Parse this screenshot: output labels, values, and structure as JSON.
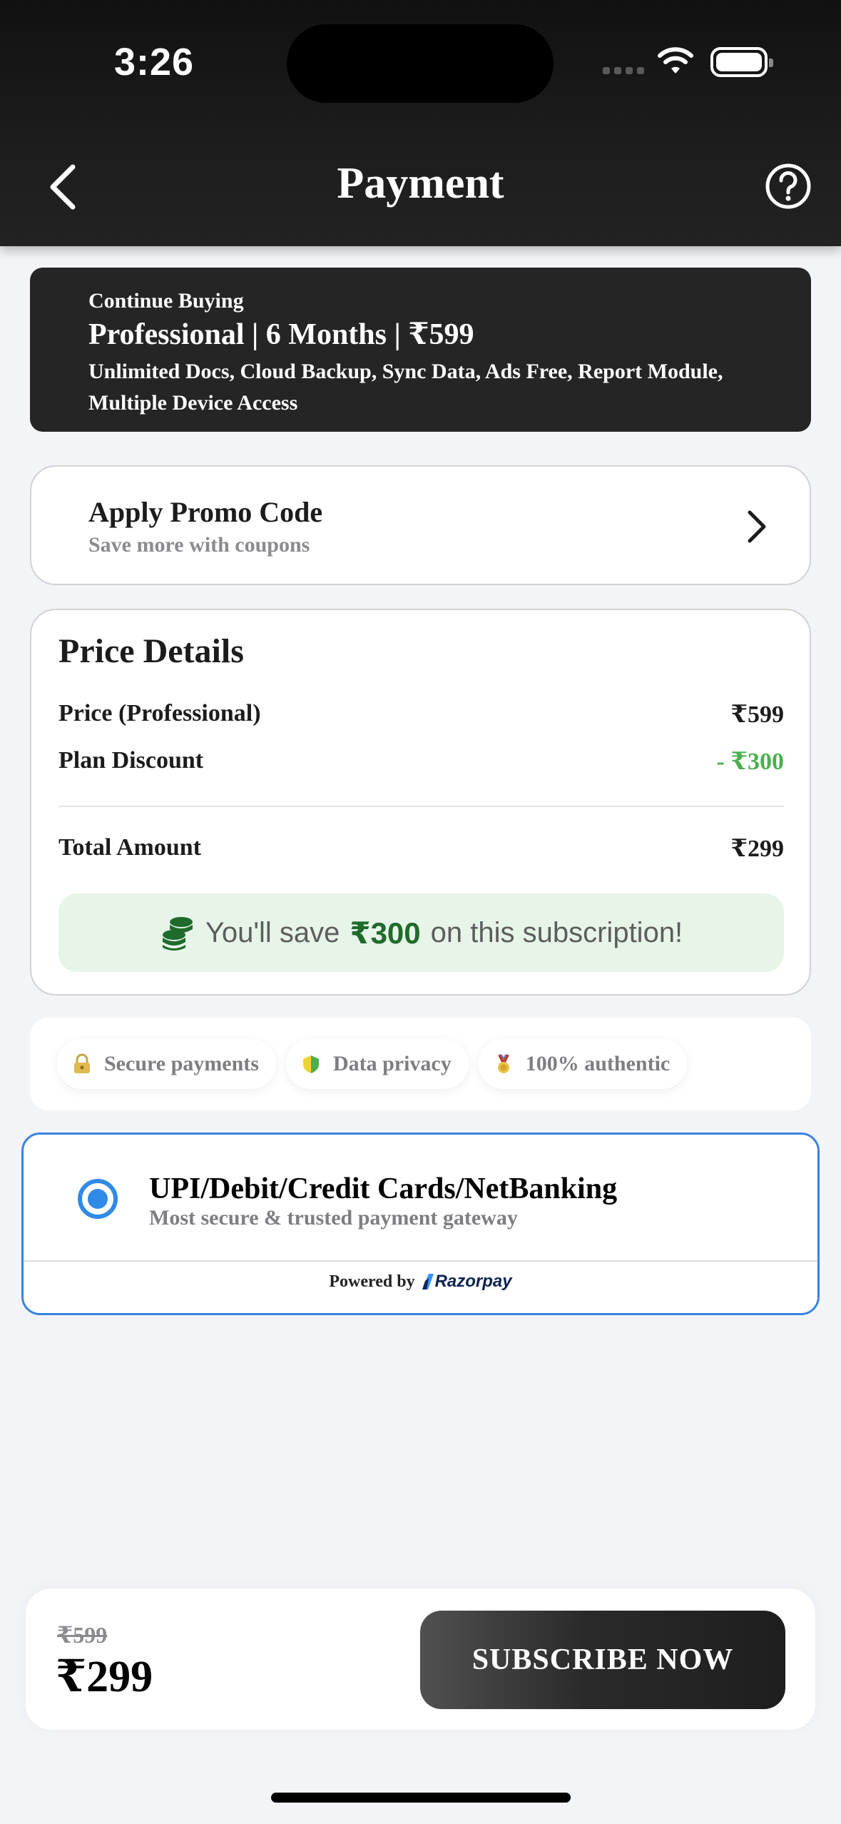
{
  "status_bar": {
    "time": "3:26"
  },
  "header": {
    "title": "Payment"
  },
  "plan": {
    "eyebrow": "Continue Buying",
    "name": "Professional | 6 Months | ₹599",
    "features": "Unlimited Docs, Cloud Backup, Sync Data, Ads Free, Report Module, Multiple Device Access"
  },
  "promo": {
    "title": "Apply Promo Code",
    "subtitle": "Save more with coupons"
  },
  "price_details": {
    "title": "Price Details",
    "rows": [
      {
        "label": "Price (Professional)",
        "value": "₹599"
      },
      {
        "label": "Plan Discount",
        "value": "- ₹300"
      }
    ],
    "total_label": "Total Amount",
    "total_value": "₹299",
    "savings": {
      "prefix": "You'll save",
      "amount": "₹300",
      "suffix": "on this subscription!"
    }
  },
  "trust_badges": [
    {
      "icon": "lock-key-icon",
      "label": "Secure payments"
    },
    {
      "icon": "shield-leaf-icon",
      "label": "Data privacy"
    },
    {
      "icon": "medal-icon",
      "label": "100% authentic"
    }
  ],
  "payment_method": {
    "title": "UPI/Debit/Credit Cards/NetBanking",
    "subtitle": "Most secure & trusted payment gateway",
    "powered_by": "Powered by",
    "provider": "Razorpay",
    "selected": true
  },
  "checkout": {
    "original_price": "₹599",
    "final_price": "₹299",
    "cta": "SUBSCRIBE NOW"
  },
  "colors": {
    "accent_blue": "#2f8ae8",
    "discount_green": "#4caf50",
    "savings_bg": "#e7f5e8",
    "dark": "#252525"
  }
}
